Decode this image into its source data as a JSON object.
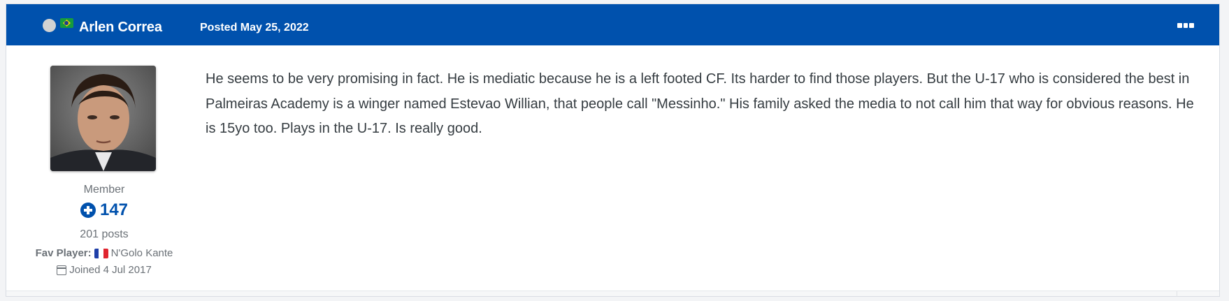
{
  "post": {
    "author_name": "Arlen Correa",
    "author_flag": "brazil-flag-icon",
    "posted_label": "Posted May 25, 2022",
    "menu_icon": "ellipsis-menu-icon",
    "content": "He seems to be very promising in fact. He is mediatic because he is a left footed CF. Its harder to find those players. But the U-17 who is considered the best in Palmeiras Academy is a winger named Estevao Willian, that people call \"Messinho.\" His family  asked the media to not call him that way for obvious reasons. He is 15yo too. Plays in the U-17. Is really good."
  },
  "author": {
    "role": "Member",
    "reputation": "147",
    "posts": "201 posts",
    "fav_label": "Fav Player:",
    "fav_player": "N'Golo Kante",
    "fav_flag": "france-flag-icon",
    "joined": "Joined 4 Jul 2017"
  },
  "colors": {
    "header_bg": "#0051ad",
    "accent": "#0051ad",
    "text": "#353c41",
    "muted": "#6b7177"
  }
}
